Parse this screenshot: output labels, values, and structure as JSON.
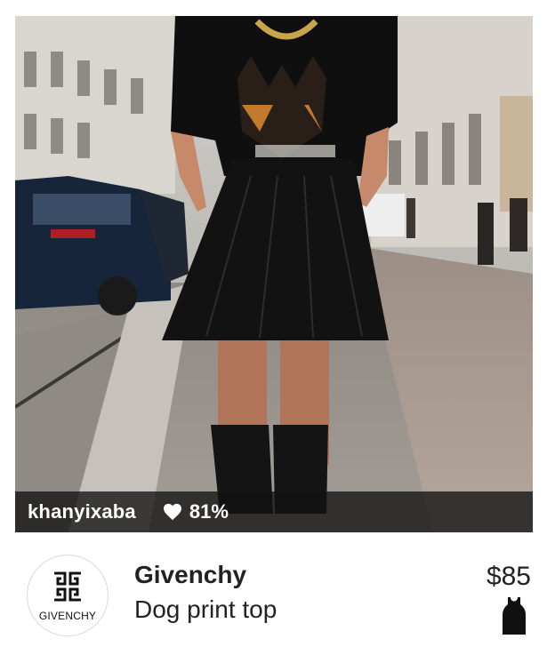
{
  "post": {
    "username": "khanyixaba",
    "like_percent": "81%",
    "heart_icon": "heart-icon"
  },
  "item": {
    "brand_logo_text": "GIVENCHY",
    "brand": "Givenchy",
    "product_name": "Dog print top",
    "price": "$85",
    "category_icon": "tank-top-icon"
  },
  "colors": {
    "overlay": "#121212",
    "text_dark": "#222222",
    "text_light": "#ffffff"
  }
}
